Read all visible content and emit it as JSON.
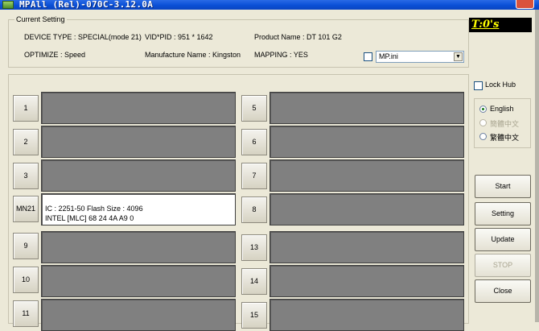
{
  "window": {
    "title": "MPAll (Rel)-070C-3.12.0A"
  },
  "current_setting": {
    "legend": "Current Setting",
    "device_type": "DEVICE TYPE : SPECIAL(mode 21)",
    "vid_pid": "VID*PID :  951 * 1642",
    "product_name": "Product Name : DT 101 G2",
    "optimize": "OPTIMIZE : Speed",
    "manufacture_name": "Manufacture Name : Kingston",
    "mapping": "MAPPING : YES",
    "ini_file": "MP.ini"
  },
  "timer": "T:0's",
  "ports": [
    {
      "label": "1",
      "lines": []
    },
    {
      "label": "2",
      "lines": []
    },
    {
      "label": "3",
      "lines": []
    },
    {
      "label": "MN21",
      "lines": [
        "IC : 2251-50  Flash Size : 4096",
        "INTEL [MLC] 68 24 4A A9 0"
      ]
    },
    {
      "label": "9",
      "lines": []
    },
    {
      "label": "10",
      "lines": []
    },
    {
      "label": "11",
      "lines": []
    },
    {
      "label": "5",
      "lines": []
    },
    {
      "label": "6",
      "lines": []
    },
    {
      "label": "7",
      "lines": []
    },
    {
      "label": "8",
      "lines": []
    },
    {
      "label": "13",
      "lines": []
    },
    {
      "label": "14",
      "lines": []
    },
    {
      "label": "15",
      "lines": []
    }
  ],
  "lock_hub": "Lock Hub",
  "languages": [
    {
      "label": "English",
      "selected": true,
      "enabled": true
    },
    {
      "label": "簡體中文",
      "selected": false,
      "enabled": false
    },
    {
      "label": "繁體中文",
      "selected": false,
      "enabled": true
    }
  ],
  "buttons": {
    "start": "Start",
    "setting": "Setting",
    "update": "Update",
    "stop": "STOP",
    "close": "Close"
  },
  "colors": {
    "title_bar": "#0a4fd6",
    "empty_port": "#808080",
    "active_port": "#ffffff",
    "timer_bg": "#000000",
    "timer_text": "#ffff00"
  }
}
